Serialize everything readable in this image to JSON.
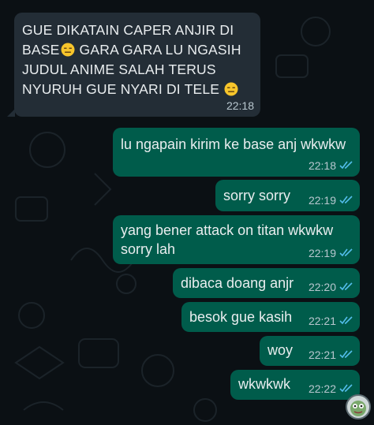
{
  "messages": [
    {
      "id": "m1",
      "direction": "incoming",
      "lines": [
        "GUE DIKATAIN CAPER ANJIR DI",
        "BASE",
        " GARA GARA LU NGASIH",
        "JUDUL ANIME SALAH TERUS",
        "NYURUH GUE NYARI DI TELE "
      ],
      "emoji": "expressionless-face-icon",
      "time": "22:18"
    },
    {
      "id": "m2",
      "direction": "outgoing",
      "lines": [
        "lu ngapain kirim ke base anj wkwkw"
      ],
      "time": "22:18",
      "status": "read"
    },
    {
      "id": "m3",
      "direction": "outgoing",
      "lines": [
        "sorry sorry"
      ],
      "time": "22:19",
      "status": "read"
    },
    {
      "id": "m4",
      "direction": "outgoing",
      "lines": [
        "yang bener attack on titan wkwkw",
        "sorry lah"
      ],
      "time": "22:19",
      "status": "read"
    },
    {
      "id": "m5",
      "direction": "outgoing",
      "lines": [
        "dibaca doang anjr"
      ],
      "time": "22:20",
      "status": "read"
    },
    {
      "id": "m6",
      "direction": "outgoing",
      "lines": [
        "besok gue kasih"
      ],
      "time": "22:21",
      "status": "read"
    },
    {
      "id": "m7",
      "direction": "outgoing",
      "lines": [
        "woy"
      ],
      "time": "22:21",
      "status": "read"
    },
    {
      "id": "m8",
      "direction": "outgoing",
      "lines": [
        "wkwkwk"
      ],
      "time": "22:22",
      "status": "read"
    }
  ],
  "colors": {
    "background": "#0b1014",
    "incoming_bubble": "#232d36",
    "outgoing_bubble": "#005c4b",
    "read_tick": "#53bdeb",
    "text": "#e9edef"
  },
  "icons": {
    "read_receipt": "double-check-icon",
    "scroll_button": "sticker-avatar-icon"
  }
}
